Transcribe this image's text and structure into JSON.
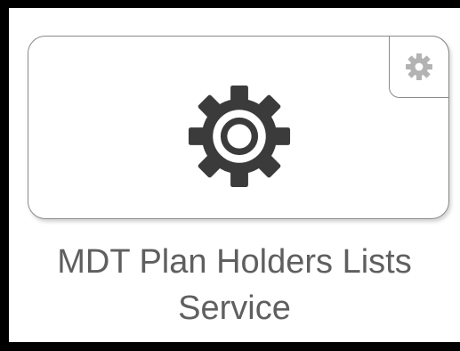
{
  "tile": {
    "label_line1": "MDT Plan Holders Lists",
    "label_line2": "Service",
    "icon": "gear-icon",
    "settings_icon": "gear-icon"
  },
  "colors": {
    "icon_main": "#3b3b3b",
    "icon_small": "#b3b3b3",
    "label": "#5f5f5f",
    "border": "#8a8a8a"
  }
}
